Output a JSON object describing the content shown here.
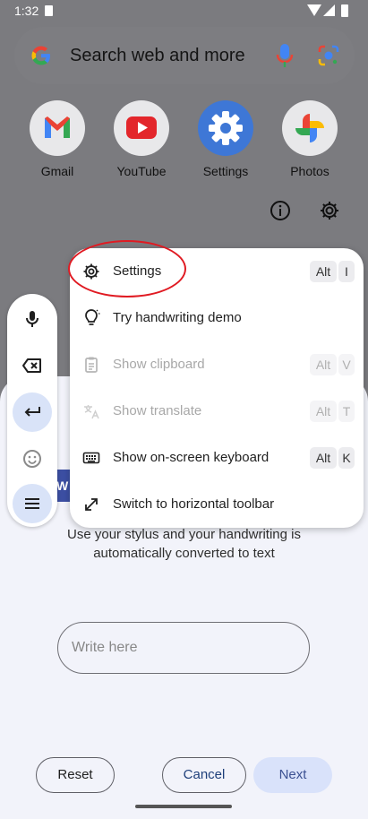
{
  "status_bar": {
    "time": "1:32"
  },
  "search": {
    "placeholder": "Search web and more"
  },
  "apps": [
    {
      "label": "Gmail"
    },
    {
      "label": "YouTube"
    },
    {
      "label": "Settings"
    },
    {
      "label": "Photos"
    }
  ],
  "menu": {
    "items": [
      {
        "label": "Settings",
        "icon": "gear-icon",
        "keys": [
          "Alt",
          "I"
        ],
        "enabled": true
      },
      {
        "label": "Try handwriting demo",
        "icon": "lightbulb-icon",
        "keys": [],
        "enabled": true
      },
      {
        "label": "Show clipboard",
        "icon": "clipboard-icon",
        "keys": [
          "Alt",
          "V"
        ],
        "enabled": false
      },
      {
        "label": "Show translate",
        "icon": "translate-icon",
        "keys": [
          "Alt",
          "T"
        ],
        "enabled": false
      },
      {
        "label": "Show on-screen keyboard",
        "icon": "keyboard-icon",
        "keys": [
          "Alt",
          "K"
        ],
        "enabled": true
      },
      {
        "label": "Switch to horizontal toolbar",
        "icon": "resize-arrow-icon",
        "keys": [],
        "enabled": true
      }
    ]
  },
  "toolbar": {
    "buttons": [
      {
        "icon": "mic-icon"
      },
      {
        "icon": "backspace-icon"
      },
      {
        "icon": "enter-icon",
        "active": true
      },
      {
        "icon": "emoji-icon"
      },
      {
        "icon": "menu-icon",
        "active": true
      }
    ]
  },
  "sheet": {
    "tag_text": "W",
    "description_line1": "Use your stylus and your handwriting is",
    "description_line2": "automatically converted to text",
    "input_placeholder": "Write here",
    "reset_label": "Reset",
    "cancel_label": "Cancel",
    "next_label": "Next"
  },
  "colors": {
    "accent": "#d9e3f8",
    "annotation": "#e01a22",
    "scrim": "#7b7b7f"
  }
}
